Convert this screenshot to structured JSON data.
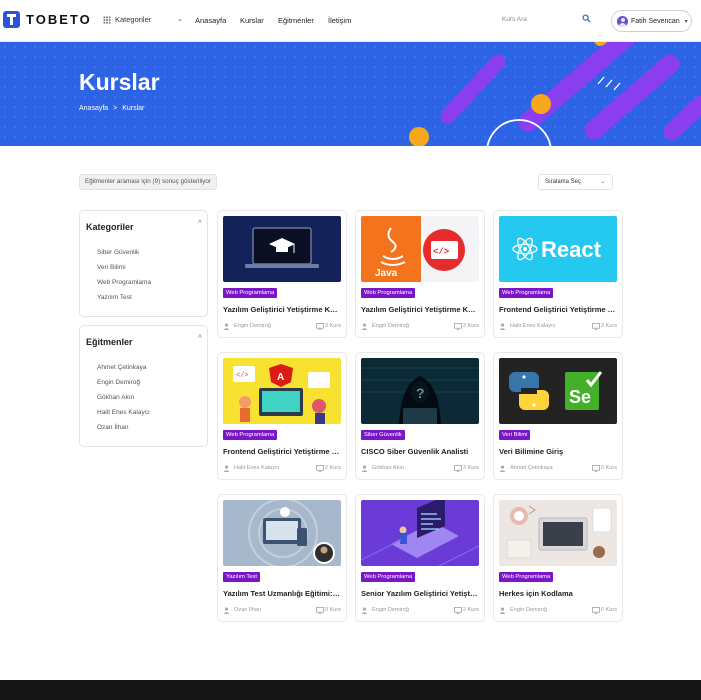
{
  "header": {
    "logo_text": "TOBETO",
    "categories_label": "Kategoriler",
    "nav": [
      "Anasayfa",
      "Kurslar",
      "Eğitmenler",
      "İletişim"
    ],
    "search_placeholder": "Kurs Ara",
    "user_name": "Fatih Sevencan"
  },
  "banner": {
    "title": "Kurslar",
    "breadcrumb_home": "Anasayfa",
    "breadcrumb_sep": ">",
    "breadcrumb_current": "Kurslar"
  },
  "toolbar": {
    "results_text": "Eğitmenler araması için (9) sonuç gösteriliyor",
    "sort_label": "Sıralama Seç"
  },
  "sidebar": {
    "categories_title": "Kategoriler",
    "categories": [
      "Siber Güvenlik",
      "Veri Bilimi",
      "Web Programlama",
      "Yazılım Test"
    ],
    "instructors_title": "Eğitmenler",
    "instructors": [
      "Ahmet Çetinkaya",
      "Engin Demiroğ",
      "Gökhan Akın",
      "Halit Enes Kalaycı",
      "Ozan İlhan"
    ]
  },
  "courses": [
    {
      "category": "Web Programlama",
      "title": "Yazılım Geliştirici Yetiştirme Kampı (.NET)",
      "instructor": "Engin Demiroğ",
      "count": "3 Kurs",
      "image": "laptop-graduation-cap"
    },
    {
      "category": "Web Programlama",
      "title": "Yazılım Geliştirici Yetiştirme Kampı (JAVA)",
      "instructor": "Engin Demiroğ",
      "count": "3 Kurs",
      "image": "java-logo"
    },
    {
      "category": "Web Programlama",
      "title": "Frontend Geliştirici Yetiştirme Kampı (React)",
      "instructor": "Halit Enes Kalaycı",
      "count": "3 Kurs",
      "image": "react-logo"
    },
    {
      "category": "Web Programlama",
      "title": "Frontend Geliştirici Yetiştirme Kampı (Angular)",
      "instructor": "Halit Enes Kalaycı",
      "count": "2 Kurs",
      "image": "frontend-illustration"
    },
    {
      "category": "Siber Güvenlik",
      "title": "CISCO Siber Güvenlik Analisti",
      "instructor": "Gökhan Akın",
      "count": "3 Kurs",
      "image": "hacker-hoodie"
    },
    {
      "category": "Veri Bilimi",
      "title": "Veri Bilimine Giriş",
      "instructor": "Ahmet Çetinkaya",
      "count": "0 Kurs",
      "image": "python-selenium"
    },
    {
      "category": "Yazılım Test",
      "title": "Yazılım Test Uzmanlığı Eğitimi: Selenium",
      "instructor": "Ozan İlhan",
      "count": "0 Kurs",
      "image": "devices-illustration"
    },
    {
      "category": "Web Programlama",
      "title": "Senior Yazılım Geliştirici Yetiştirme Kampı",
      "instructor": "Engin Demiroğ",
      "count": "2 Kurs",
      "image": "isometric-code"
    },
    {
      "category": "Web Programlama",
      "title": "Herkes için Kodlama",
      "instructor": "Engin Demiroğ",
      "count": "0 Kurs",
      "image": "desk-flatlay"
    }
  ],
  "colors": {
    "brand_blue": "#2d64e5",
    "badge_purple": "#7b16c8",
    "accent_orange": "#f7a71c",
    "footer": "#161616"
  }
}
